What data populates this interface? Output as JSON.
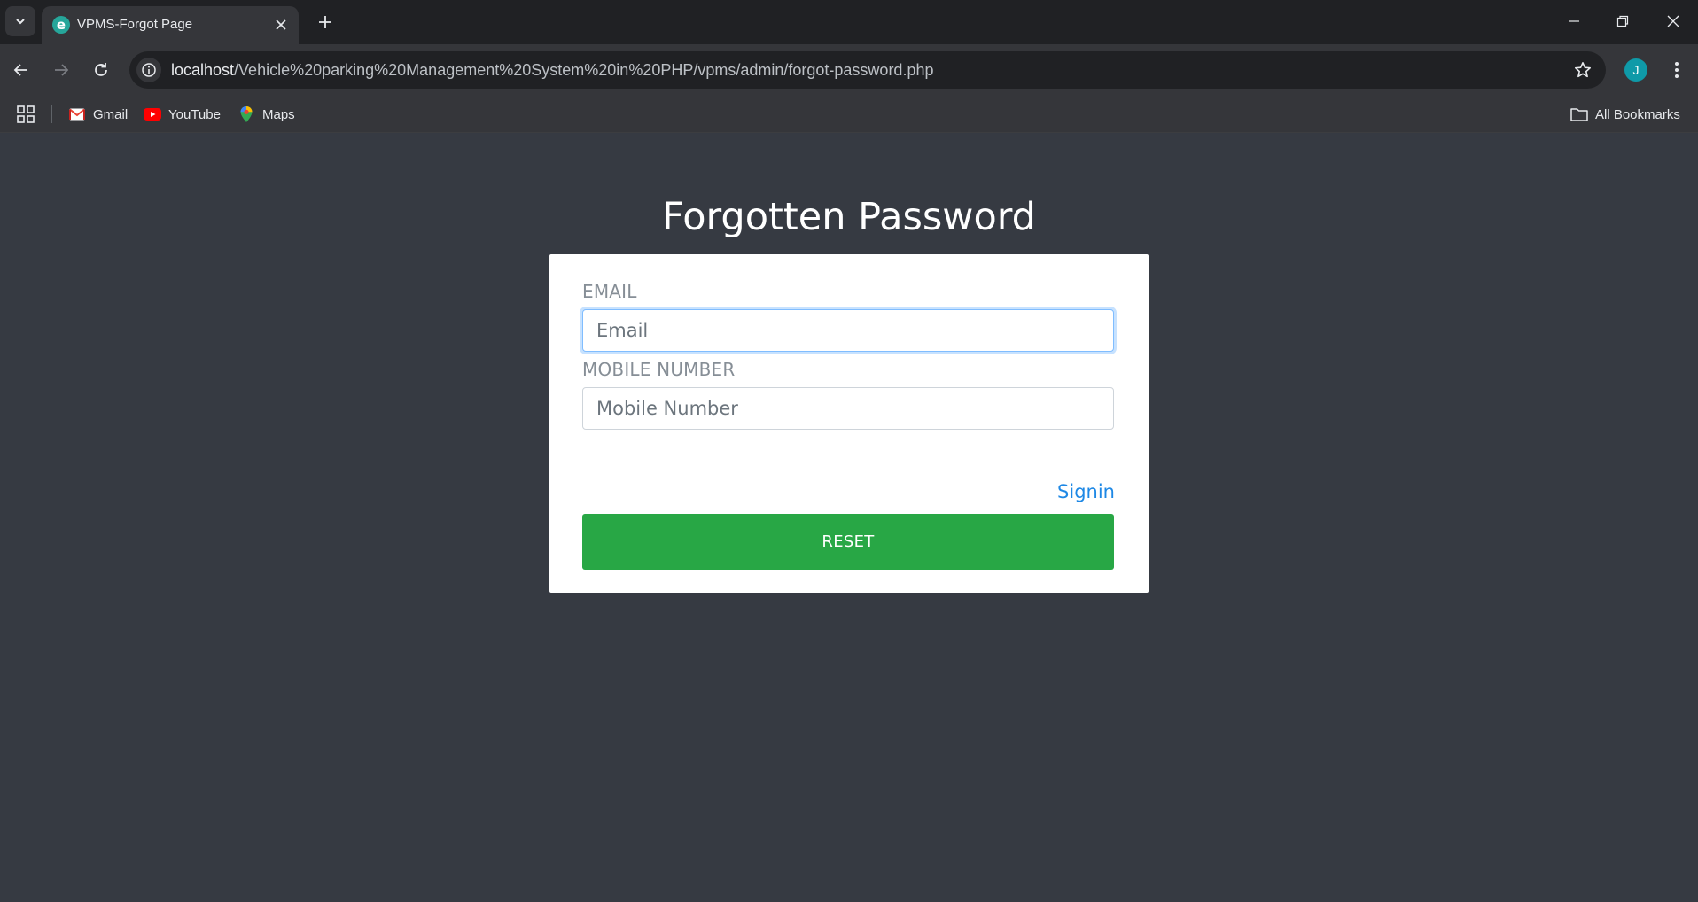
{
  "browser": {
    "tab_title": "VPMS-Forgot Page",
    "tab_favicon_letter": "e",
    "url_host": "localhost",
    "url_path": "/Vehicle%20parking%20Management%20System%20in%20PHP/vpms/admin/forgot-password.php",
    "profile_initial": "J",
    "bookmarks": [
      {
        "label": "Gmail",
        "icon": "gmail-icon"
      },
      {
        "label": "YouTube",
        "icon": "youtube-icon"
      },
      {
        "label": "Maps",
        "icon": "maps-icon"
      }
    ],
    "all_bookmarks_label": "All Bookmarks"
  },
  "page": {
    "title": "Forgotten Password",
    "email_label": "EMAIL",
    "email_placeholder": "Email",
    "email_value": "",
    "mobile_label": "MOBILE NUMBER",
    "mobile_placeholder": "Mobile Number",
    "mobile_value": "",
    "signin_link": "Signin",
    "reset_button": "RESET"
  },
  "colors": {
    "page_background": "#363a42",
    "reset_button": "#28a745",
    "link": "#1e88e5",
    "focus_ring": "#80bdff"
  }
}
